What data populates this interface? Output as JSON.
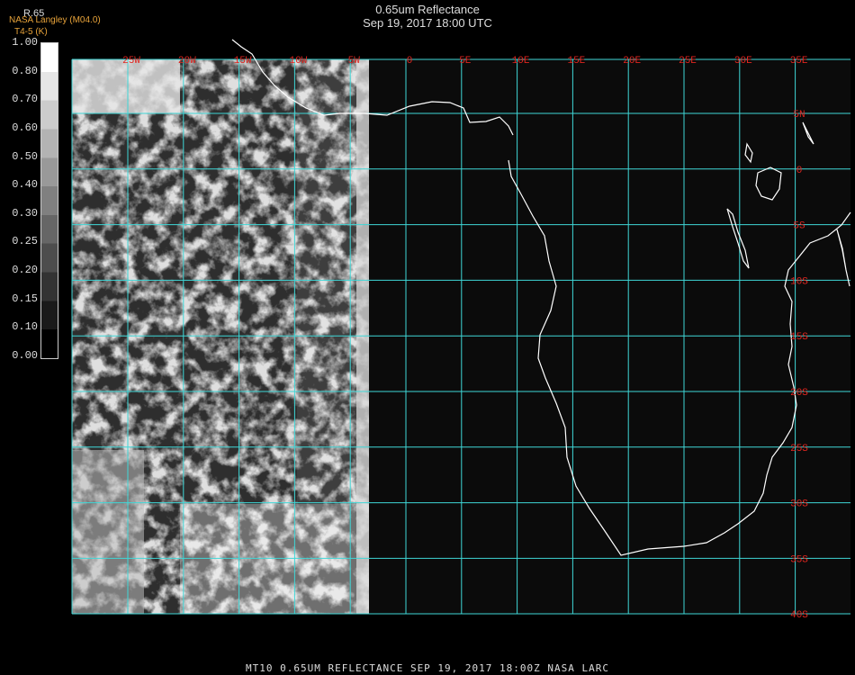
{
  "header": {
    "title": "0.65um Reflectance",
    "timestamp": "Sep 19, 2017 18:00 UTC",
    "credit_line1": "NASA Langley (M04.0)",
    "credit_line2": "T4-5 (K)",
    "channel_label": "R.65"
  },
  "colorbar": {
    "ticks": [
      "1.00",
      "0.80",
      "0.70",
      "0.60",
      "0.50",
      "0.40",
      "0.30",
      "0.25",
      "0.20",
      "0.15",
      "0.10",
      "0.00"
    ]
  },
  "map": {
    "lon_labels": [
      "25W",
      "20W",
      "15W",
      "10W",
      "5W",
      "0",
      "5E",
      "10E",
      "15E",
      "20E",
      "25E",
      "30E",
      "35E"
    ],
    "lat_labels": [
      "5N",
      "0",
      "5S",
      "10S",
      "15S",
      "20S",
      "25S",
      "30S",
      "35S",
      "40S"
    ],
    "grid_color": "#3fd7d7",
    "label_color": "#e0251f",
    "coast_color": "#ffffff"
  },
  "footer": {
    "caption": "MT10  0.65UM REFLECTANCE   SEP 19, 2017 18:00Z   NASA LARC"
  }
}
